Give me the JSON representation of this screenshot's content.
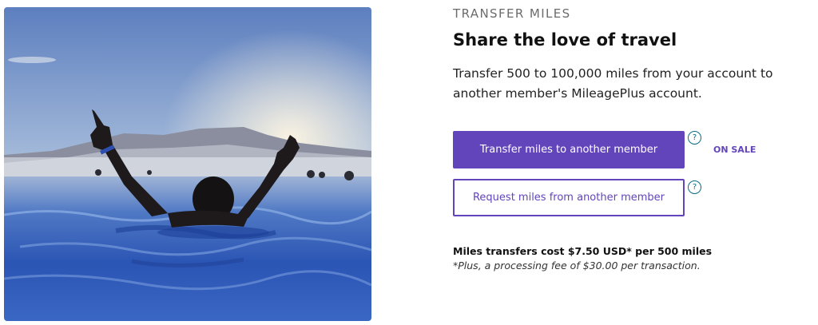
{
  "hero_image": {
    "description_icon": "person-in-hot-spring-image"
  },
  "section": {
    "eyebrow": "TRANSFER MILES",
    "headline": "Share the love of travel",
    "description": "Transfer 500 to 100,000 miles from your account to another member's MileagePlus account."
  },
  "actions": {
    "transfer_label": "Transfer miles to another member",
    "request_label": "Request miles from another member",
    "help_glyph": "?",
    "sale_badge": "ON SALE"
  },
  "pricing": {
    "cost_text": "Miles transfers cost $7.50 USD* per 500 miles",
    "fee_text": "*Plus, a processing fee of $30.00 per transaction."
  },
  "colors": {
    "brand_purple": "#6244bb",
    "help_teal": "#0b6b83"
  }
}
